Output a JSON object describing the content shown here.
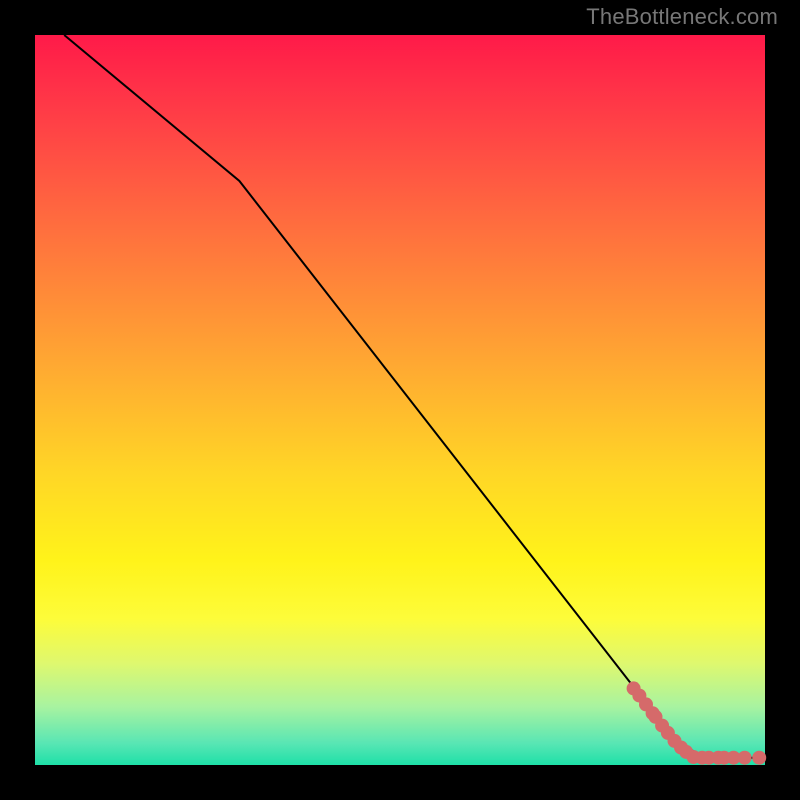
{
  "attribution": "TheBottleneck.com",
  "chart_data": {
    "type": "line",
    "title": "",
    "xlabel": "",
    "ylabel": "",
    "xlim": [
      0,
      100
    ],
    "ylim": [
      0,
      100
    ],
    "curve": [
      {
        "x": 4,
        "y": 100
      },
      {
        "x": 28,
        "y": 80
      },
      {
        "x": 88,
        "y": 3
      },
      {
        "x": 92,
        "y": 1
      },
      {
        "x": 100,
        "y": 1
      }
    ],
    "markers": [
      {
        "x": 82.0,
        "y": 10.5
      },
      {
        "x": 82.8,
        "y": 9.5
      },
      {
        "x": 83.7,
        "y": 8.3
      },
      {
        "x": 84.6,
        "y": 7.1
      },
      {
        "x": 85.0,
        "y": 6.6
      },
      {
        "x": 85.9,
        "y": 5.4
      },
      {
        "x": 86.7,
        "y": 4.4
      },
      {
        "x": 87.6,
        "y": 3.3
      },
      {
        "x": 88.5,
        "y": 2.4
      },
      {
        "x": 89.2,
        "y": 1.8
      },
      {
        "x": 90.2,
        "y": 1.1
      },
      {
        "x": 91.4,
        "y": 1.0
      },
      {
        "x": 92.3,
        "y": 1.0
      },
      {
        "x": 93.6,
        "y": 1.0
      },
      {
        "x": 94.4,
        "y": 1.0
      },
      {
        "x": 95.7,
        "y": 1.0
      },
      {
        "x": 97.2,
        "y": 1.0
      },
      {
        "x": 99.2,
        "y": 1.0
      }
    ],
    "gradient_stops": [
      {
        "pos": 0,
        "color": "#ff1a49"
      },
      {
        "pos": 25,
        "color": "#ff6a3f"
      },
      {
        "pos": 60,
        "color": "#ffd626"
      },
      {
        "pos": 80,
        "color": "#fdfc3a"
      },
      {
        "pos": 100,
        "color": "#1ee0a8"
      }
    ]
  }
}
